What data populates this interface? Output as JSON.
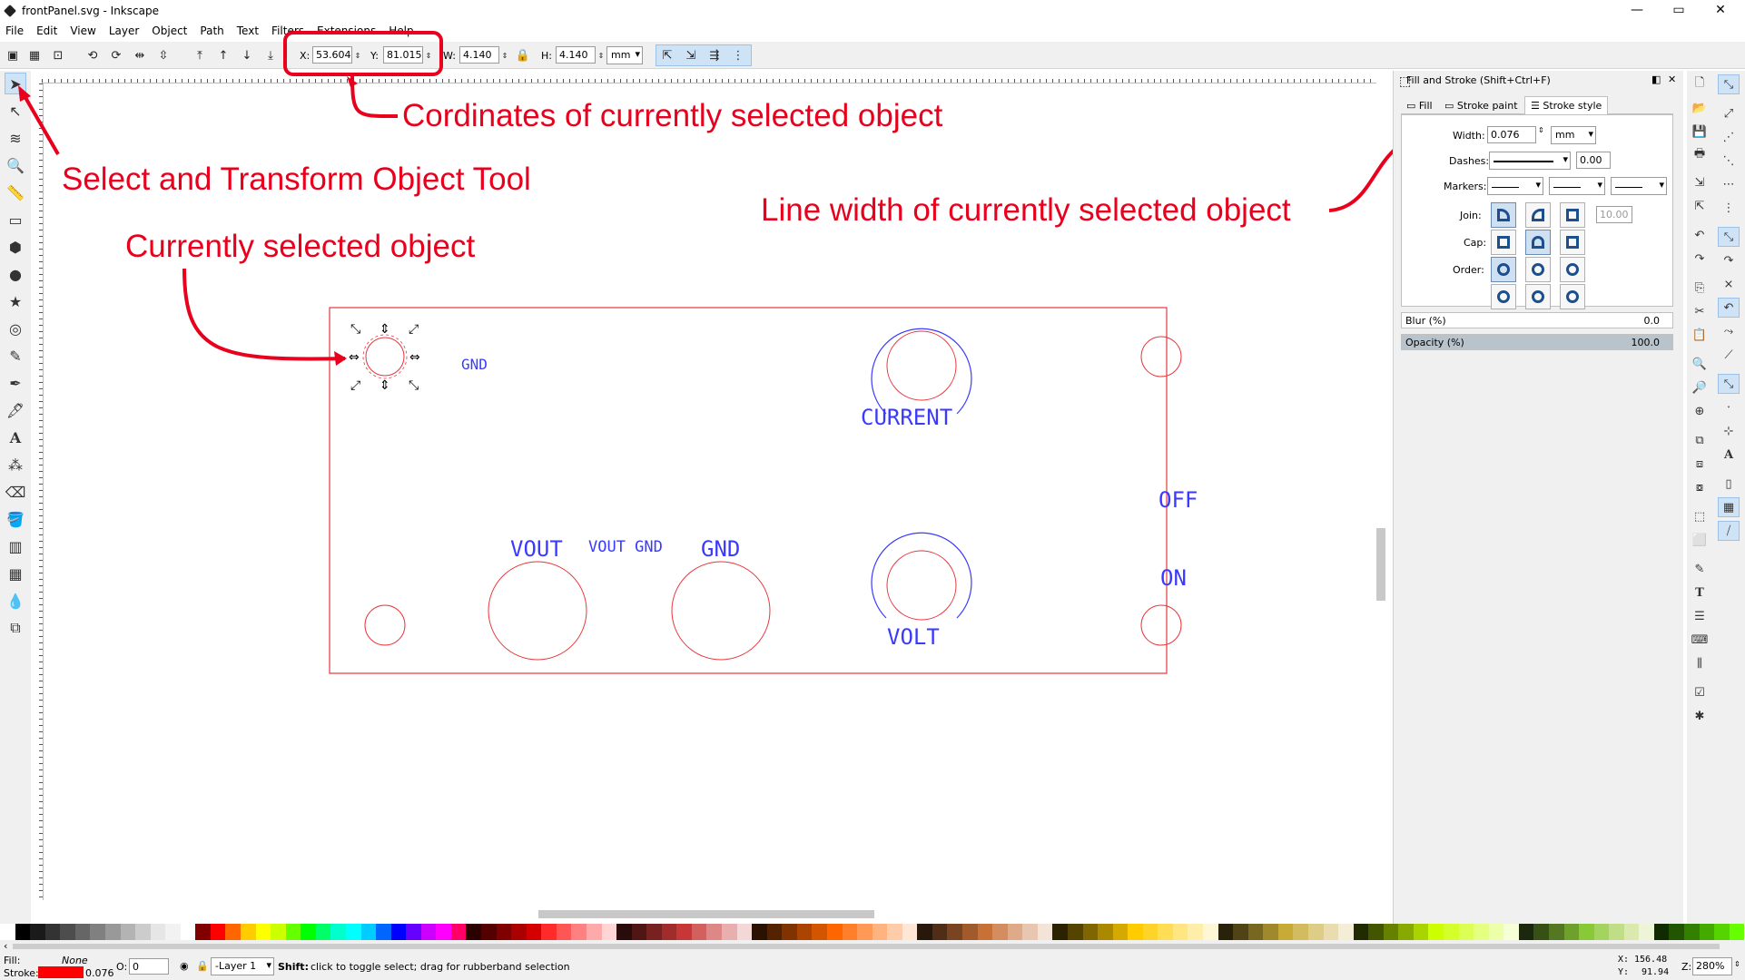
{
  "window": {
    "title": "frontPanel.svg - Inkscape",
    "minimize": "—",
    "maximize": "▭",
    "close": "✕"
  },
  "menu": [
    "File",
    "Edit",
    "View",
    "Layer",
    "Object",
    "Path",
    "Text",
    "Filters",
    "Extensions",
    "Help"
  ],
  "toolbar": {
    "x_label": "X:",
    "x_value": "53.604",
    "y_label": "Y:",
    "y_value": "81.015",
    "w_label": "W:",
    "w_value": "4.140",
    "h_label": "H:",
    "h_value": "4.140",
    "unit": "mm"
  },
  "panel": {
    "title": "Fill and Stroke (Shift+Ctrl+F)",
    "tabs": [
      "Fill",
      "Stroke paint",
      "Stroke style"
    ],
    "width_label": "Width:",
    "width_value": "0.076",
    "width_unit": "mm",
    "dashes_label": "Dashes:",
    "dashes_value": "0.00",
    "markers_label": "Markers:",
    "join_label": "Join:",
    "miter_value": "10.00",
    "cap_label": "Cap:",
    "order_label": "Order:",
    "blur_label": "Blur (%)",
    "blur_value": "0.0",
    "opacity_label": "Opacity (%)",
    "opacity_value": "100.0",
    "opacity_level": 1.0
  },
  "drawing": {
    "labels": {
      "gnd_small": "GND",
      "current": "CURRENT",
      "off": "OFF",
      "on": "ON",
      "vout": "VOUT",
      "vout_gnd": "VOUT GND",
      "gnd": "GND",
      "volt": "VOLT"
    }
  },
  "annotations": {
    "coords": "Cordinates of currently selected object",
    "select_tool": "Select and Transform Object Tool",
    "line_width": "Line width of currently selected object",
    "selected": "Currently selected object"
  },
  "statusbar": {
    "fill_label": "Fill:",
    "fill_value": "None",
    "stroke_label": "Stroke:",
    "stroke_value": "0.076",
    "opacity_label": "O:",
    "opacity_value": "0",
    "layer": "-Layer 1",
    "hint_bold": "Shift:",
    "hint": "click to toggle select; drag for rubberband selection",
    "cursor_x_label": "X:",
    "cursor_x": "156.48",
    "cursor_y_label": "Y:",
    "cursor_y": "91.94",
    "zoom_label": "Z:",
    "zoom": "280%"
  },
  "colors": {
    "annotation": "#e8001c",
    "panel_outline": "#e8353b",
    "text_blue": "#3a3aff",
    "stroke_swatch": "#ff0000"
  }
}
